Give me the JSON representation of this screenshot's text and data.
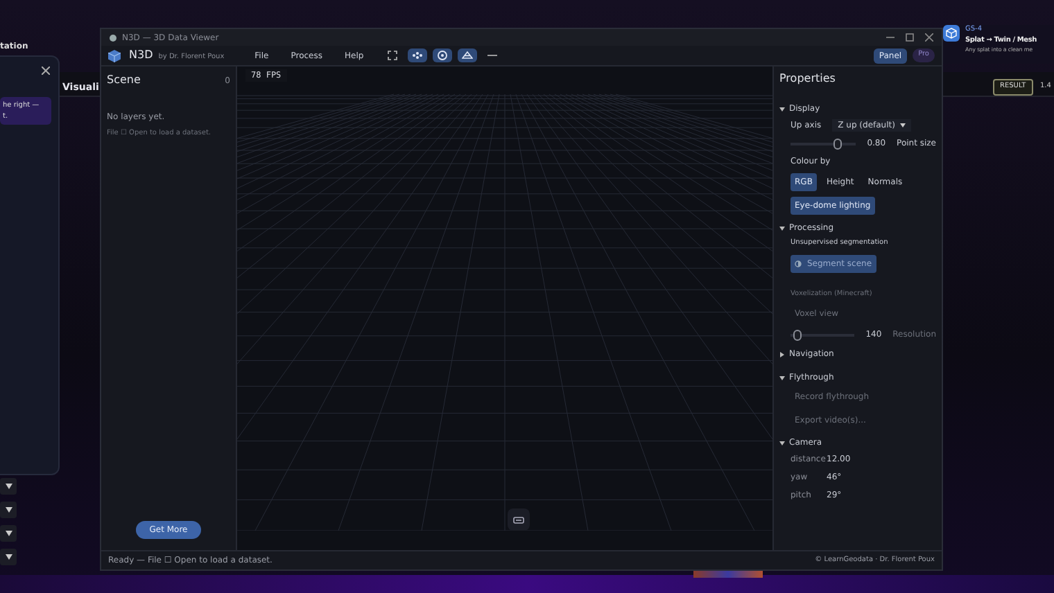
{
  "background": {
    "left_panel": {
      "title": "tation",
      "note": [
        "he right —",
        "t."
      ]
    },
    "page_heading": "Visuali",
    "notification": {
      "tag": "GS-4",
      "title": "Splat → Twin / Mesh",
      "text": "Any splat into a clean me"
    },
    "result_button": "RESULT",
    "result_value": "1.4",
    "dropdowns": [
      {
        "expanded": false
      },
      {
        "expanded": false
      },
      {
        "expanded": false
      },
      {
        "expanded": false
      }
    ]
  },
  "window": {
    "title": "N3D — 3D Data Viewer"
  },
  "app": {
    "name": "N3D",
    "byline": "by Dr. Florent Poux"
  },
  "menu": [
    "File",
    "Process",
    "Help"
  ],
  "toolbar": [
    {
      "kind": "fullscreen",
      "selected": false
    },
    {
      "kind": "points",
      "selected": true
    },
    {
      "kind": "orbit",
      "selected": true
    },
    {
      "kind": "mesh",
      "selected": true
    },
    {
      "kind": "line",
      "selected": false
    }
  ],
  "header_buttons": [
    {
      "label": "Panel",
      "kind": "button"
    },
    {
      "label": "Pro",
      "kind": "badge"
    }
  ],
  "scene": {
    "title": "Scene",
    "count": "0",
    "empty": "No layers yet.",
    "hint": "File ☐ Open to load a dataset.",
    "button": "Get More"
  },
  "viewport": {
    "fps": "78 FPS"
  },
  "properties": {
    "title": "Properties",
    "sections": [
      {
        "title": "Display",
        "kind": "display",
        "expanded": true,
        "up_axis": {
          "label": "Up axis",
          "value": "Z up (default)"
        },
        "point_size": {
          "level": 0.75,
          "reading": "0.80",
          "label": "Point size"
        },
        "colour_by": {
          "label": "Colour by",
          "options": [
            {
              "label": "RGB",
              "selected": true
            },
            {
              "label": "Height",
              "selected": false
            },
            {
              "label": "Normals",
              "selected": false
            }
          ]
        },
        "eye_dome": {
          "label": "Eye-dome lighting",
          "on": true
        }
      },
      {
        "title": "Processing",
        "kind": "processing",
        "expanded": true,
        "segmentation": {
          "label": "Unsupervised segmentation",
          "button": "Segment scene"
        },
        "voxel": {
          "label": "Voxelization (Minecraft)",
          "button": "Voxel view",
          "disabled": true,
          "level": 0.05,
          "reading": "140",
          "slider_label": "Resolution"
        }
      },
      {
        "title": "Navigation",
        "kind": "navigation",
        "expanded": false
      },
      {
        "title": "Flythrough",
        "kind": "flythrough",
        "expanded": true,
        "buttons": [
          {
            "label": "Record flythrough",
            "disabled": true
          },
          {
            "label": "Export video(s)...",
            "disabled": true
          }
        ]
      },
      {
        "title": "Camera",
        "kind": "camera",
        "expanded": true,
        "rows": [
          {
            "label": "distance",
            "value": "12.00"
          },
          {
            "label": "yaw",
            "value": "46°"
          },
          {
            "label": "pitch",
            "value": "29°"
          }
        ]
      }
    ]
  },
  "status_bar": {
    "text": "Ready — File ☐ Open to load a dataset.",
    "credit": "© LearnGeodata · Dr. Florent Poux"
  }
}
